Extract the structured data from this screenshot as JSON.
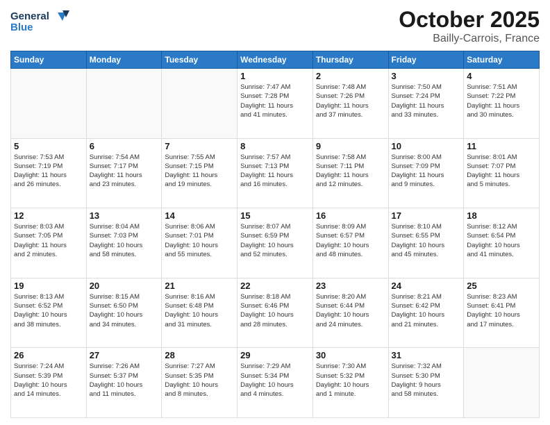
{
  "logo": {
    "line1": "General",
    "line2": "Blue"
  },
  "title": "October 2025",
  "location": "Bailly-Carrois, France",
  "days_header": [
    "Sunday",
    "Monday",
    "Tuesday",
    "Wednesday",
    "Thursday",
    "Friday",
    "Saturday"
  ],
  "weeks": [
    [
      {
        "day": "",
        "info": ""
      },
      {
        "day": "",
        "info": ""
      },
      {
        "day": "",
        "info": ""
      },
      {
        "day": "1",
        "info": "Sunrise: 7:47 AM\nSunset: 7:28 PM\nDaylight: 11 hours\nand 41 minutes."
      },
      {
        "day": "2",
        "info": "Sunrise: 7:48 AM\nSunset: 7:26 PM\nDaylight: 11 hours\nand 37 minutes."
      },
      {
        "day": "3",
        "info": "Sunrise: 7:50 AM\nSunset: 7:24 PM\nDaylight: 11 hours\nand 33 minutes."
      },
      {
        "day": "4",
        "info": "Sunrise: 7:51 AM\nSunset: 7:22 PM\nDaylight: 11 hours\nand 30 minutes."
      }
    ],
    [
      {
        "day": "5",
        "info": "Sunrise: 7:53 AM\nSunset: 7:19 PM\nDaylight: 11 hours\nand 26 minutes."
      },
      {
        "day": "6",
        "info": "Sunrise: 7:54 AM\nSunset: 7:17 PM\nDaylight: 11 hours\nand 23 minutes."
      },
      {
        "day": "7",
        "info": "Sunrise: 7:55 AM\nSunset: 7:15 PM\nDaylight: 11 hours\nand 19 minutes."
      },
      {
        "day": "8",
        "info": "Sunrise: 7:57 AM\nSunset: 7:13 PM\nDaylight: 11 hours\nand 16 minutes."
      },
      {
        "day": "9",
        "info": "Sunrise: 7:58 AM\nSunset: 7:11 PM\nDaylight: 11 hours\nand 12 minutes."
      },
      {
        "day": "10",
        "info": "Sunrise: 8:00 AM\nSunset: 7:09 PM\nDaylight: 11 hours\nand 9 minutes."
      },
      {
        "day": "11",
        "info": "Sunrise: 8:01 AM\nSunset: 7:07 PM\nDaylight: 11 hours\nand 5 minutes."
      }
    ],
    [
      {
        "day": "12",
        "info": "Sunrise: 8:03 AM\nSunset: 7:05 PM\nDaylight: 11 hours\nand 2 minutes."
      },
      {
        "day": "13",
        "info": "Sunrise: 8:04 AM\nSunset: 7:03 PM\nDaylight: 10 hours\nand 58 minutes."
      },
      {
        "day": "14",
        "info": "Sunrise: 8:06 AM\nSunset: 7:01 PM\nDaylight: 10 hours\nand 55 minutes."
      },
      {
        "day": "15",
        "info": "Sunrise: 8:07 AM\nSunset: 6:59 PM\nDaylight: 10 hours\nand 52 minutes."
      },
      {
        "day": "16",
        "info": "Sunrise: 8:09 AM\nSunset: 6:57 PM\nDaylight: 10 hours\nand 48 minutes."
      },
      {
        "day": "17",
        "info": "Sunrise: 8:10 AM\nSunset: 6:55 PM\nDaylight: 10 hours\nand 45 minutes."
      },
      {
        "day": "18",
        "info": "Sunrise: 8:12 AM\nSunset: 6:54 PM\nDaylight: 10 hours\nand 41 minutes."
      }
    ],
    [
      {
        "day": "19",
        "info": "Sunrise: 8:13 AM\nSunset: 6:52 PM\nDaylight: 10 hours\nand 38 minutes."
      },
      {
        "day": "20",
        "info": "Sunrise: 8:15 AM\nSunset: 6:50 PM\nDaylight: 10 hours\nand 34 minutes."
      },
      {
        "day": "21",
        "info": "Sunrise: 8:16 AM\nSunset: 6:48 PM\nDaylight: 10 hours\nand 31 minutes."
      },
      {
        "day": "22",
        "info": "Sunrise: 8:18 AM\nSunset: 6:46 PM\nDaylight: 10 hours\nand 28 minutes."
      },
      {
        "day": "23",
        "info": "Sunrise: 8:20 AM\nSunset: 6:44 PM\nDaylight: 10 hours\nand 24 minutes."
      },
      {
        "day": "24",
        "info": "Sunrise: 8:21 AM\nSunset: 6:42 PM\nDaylight: 10 hours\nand 21 minutes."
      },
      {
        "day": "25",
        "info": "Sunrise: 8:23 AM\nSunset: 6:41 PM\nDaylight: 10 hours\nand 17 minutes."
      }
    ],
    [
      {
        "day": "26",
        "info": "Sunrise: 7:24 AM\nSunset: 5:39 PM\nDaylight: 10 hours\nand 14 minutes."
      },
      {
        "day": "27",
        "info": "Sunrise: 7:26 AM\nSunset: 5:37 PM\nDaylight: 10 hours\nand 11 minutes."
      },
      {
        "day": "28",
        "info": "Sunrise: 7:27 AM\nSunset: 5:35 PM\nDaylight: 10 hours\nand 8 minutes."
      },
      {
        "day": "29",
        "info": "Sunrise: 7:29 AM\nSunset: 5:34 PM\nDaylight: 10 hours\nand 4 minutes."
      },
      {
        "day": "30",
        "info": "Sunrise: 7:30 AM\nSunset: 5:32 PM\nDaylight: 10 hours\nand 1 minute."
      },
      {
        "day": "31",
        "info": "Sunrise: 7:32 AM\nSunset: 5:30 PM\nDaylight: 9 hours\nand 58 minutes."
      },
      {
        "day": "",
        "info": ""
      }
    ]
  ]
}
